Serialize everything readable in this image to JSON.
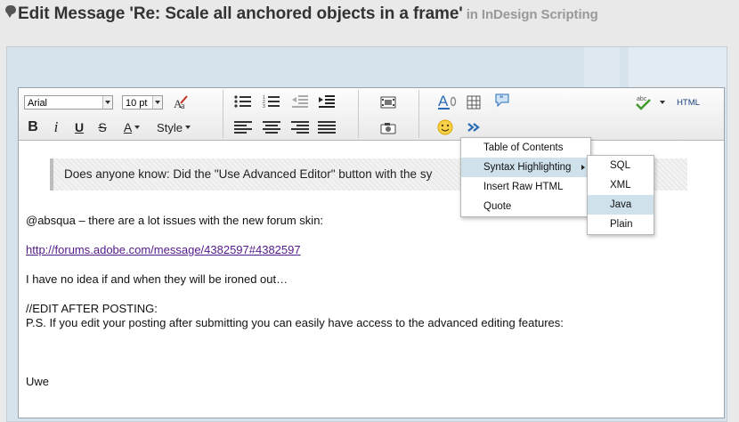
{
  "page": {
    "title": "Edit Message 'Re: Scale all anchored objects in a frame'",
    "in_label": "in InDesign Scripting"
  },
  "toolbar": {
    "font_family": "Arial",
    "font_size": "10 pt",
    "style_label": "Style",
    "html_label": "HTML"
  },
  "content": {
    "quote_text": "Does anyone know: Did the \"Use Advanced Editor\" button with the sy",
    "para1": "@absqua – there are a lot issues with the new forum skin:",
    "link": "http://forums.adobe.com/message/4382597#4382597",
    "para2": "I have no idea if and when they will be ironed out…",
    "para3a": "//EDIT AFTER POSTING:",
    "para3b": "P.S. If you edit your posting after submitting you can easily have access to the advanced editing features:",
    "signature": "Uwe"
  },
  "insert_menu": {
    "items": [
      "Table of Contents",
      "Syntax Highlighting",
      "Insert Raw HTML",
      "Quote"
    ],
    "highlighted": "Syntax Highlighting"
  },
  "syntax_menu": {
    "items": [
      "SQL",
      "XML",
      "Java",
      "Plain"
    ],
    "highlighted": "Java"
  },
  "colors": {
    "accent_blue": "#2a6bb5",
    "link_visited": "#551a8b",
    "menu_highlight": "#cfe1eb"
  }
}
